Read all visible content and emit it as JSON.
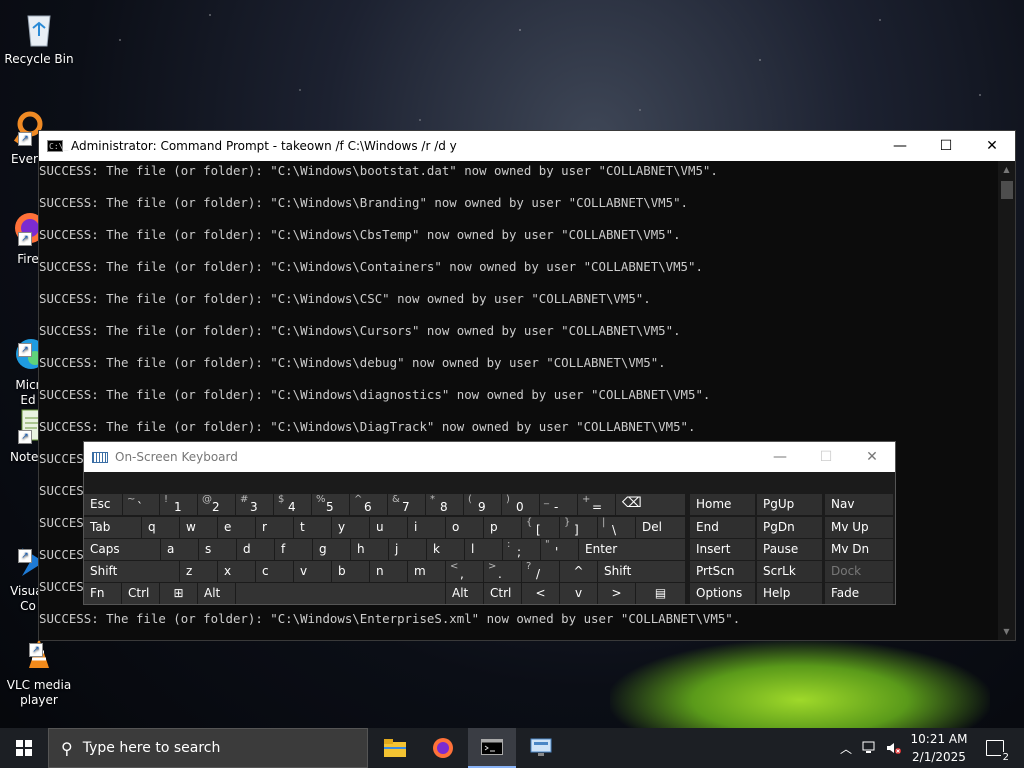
{
  "desktop": {
    "icons": [
      {
        "label": "Recycle Bin"
      },
      {
        "label": "Every"
      },
      {
        "label": "Fire"
      },
      {
        "label": "Micr\nEd"
      },
      {
        "label": "Notep"
      },
      {
        "label": "Visual\nCo"
      },
      {
        "label": "VLC media\nplayer"
      }
    ]
  },
  "cmd": {
    "title": "Administrator: Command Prompt - takeown  /f C:\\Windows /r /d y",
    "icon_text": "C:\\_",
    "lines": [
      "SUCCESS: The file (or folder): \"C:\\Windows\\bootstat.dat\" now owned by user \"COLLABNET\\VM5\".",
      "SUCCESS: The file (or folder): \"C:\\Windows\\Branding\" now owned by user \"COLLABNET\\VM5\".",
      "SUCCESS: The file (or folder): \"C:\\Windows\\CbsTemp\" now owned by user \"COLLABNET\\VM5\".",
      "SUCCESS: The file (or folder): \"C:\\Windows\\Containers\" now owned by user \"COLLABNET\\VM5\".",
      "SUCCESS: The file (or folder): \"C:\\Windows\\CSC\" now owned by user \"COLLABNET\\VM5\".",
      "SUCCESS: The file (or folder): \"C:\\Windows\\Cursors\" now owned by user \"COLLABNET\\VM5\".",
      "SUCCESS: The file (or folder): \"C:\\Windows\\debug\" now owned by user \"COLLABNET\\VM5\".",
      "SUCCESS: The file (or folder): \"C:\\Windows\\diagnostics\" now owned by user \"COLLABNET\\VM5\".",
      "SUCCESS: The file (or folder): \"C:\\Windows\\DiagTrack\" now owned by user \"COLLABNET\\VM5\".",
      "SUCCESS",
      "SUCCESS",
      "SUCCESS",
      "SUCCESS",
      "SUCCESS",
      "SUCCESS: The file (or folder): \"C:\\Windows\\EnterpriseS.xml\" now owned by user \"COLLABNET\\VM5\"."
    ]
  },
  "osk": {
    "title": "On-Screen Keyboard",
    "keys": {
      "esc": "Esc",
      "tilde_top": "~",
      "tilde_bot": "`",
      "k1_top": "!",
      "k1": "1",
      "k2_top": "@",
      "k2": "2",
      "k3_top": "#",
      "k3": "3",
      "k4_top": "$",
      "k4": "4",
      "k5_top": "%",
      "k5": "5",
      "k6_top": "^",
      "k6": "6",
      "k7_top": "&",
      "k7": "7",
      "k8_top": "*",
      "k8": "8",
      "k9_top": "(",
      "k9": "9",
      "k0_top": ")",
      "k0": "0",
      "minus_top": "_",
      "minus": "-",
      "eq_top": "+",
      "eq": "=",
      "backspace": "⌫",
      "tab": "Tab",
      "q": "q",
      "w": "w",
      "e": "e",
      "r": "r",
      "t": "t",
      "y": "y",
      "u": "u",
      "i": "i",
      "o": "o",
      "p": "p",
      "lbr_top": "{",
      "lbr": "[",
      "rbr_top": "}",
      "rbr": "]",
      "bs_top": "|",
      "bs": "\\",
      "del": "Del",
      "caps": "Caps",
      "a": "a",
      "s": "s",
      "d": "d",
      "f": "f",
      "g": "g",
      "h": "h",
      "j": "j",
      "k": "k",
      "l": "l",
      "semi_top": ":",
      "semi": ";",
      "quote_top": "\"",
      "quote": "'",
      "enter": "Enter",
      "shift": "Shift",
      "z": "z",
      "x": "x",
      "c": "c",
      "v": "v",
      "b": "b",
      "n": "n",
      "m": "m",
      "comma_top": "<",
      "comma": ",",
      "period_top": ">",
      "period": ".",
      "slash_top": "?",
      "slash": "/",
      "up": "^",
      "shift_r": "Shift",
      "fn": "Fn",
      "ctrl": "Ctrl",
      "win": "⊞",
      "alt": "Alt",
      "alt_r": "Alt",
      "ctrl_r": "Ctrl",
      "left": "<",
      "down": "v",
      "right": ">",
      "menu": "▤",
      "home": "Home",
      "pgup": "PgUp",
      "nav": "Nav",
      "end": "End",
      "pgdn": "PgDn",
      "mvup": "Mv Up",
      "insert": "Insert",
      "pause": "Pause",
      "mvdn": "Mv Dn",
      "prtscn": "PrtScn",
      "scrlk": "ScrLk",
      "dock": "Dock",
      "options": "Options",
      "help": "Help",
      "fade": "Fade"
    }
  },
  "taskbar": {
    "search_placeholder": "Type here to search",
    "time": "10:21 AM",
    "date": "2/1/2025",
    "notification_count": "2"
  }
}
